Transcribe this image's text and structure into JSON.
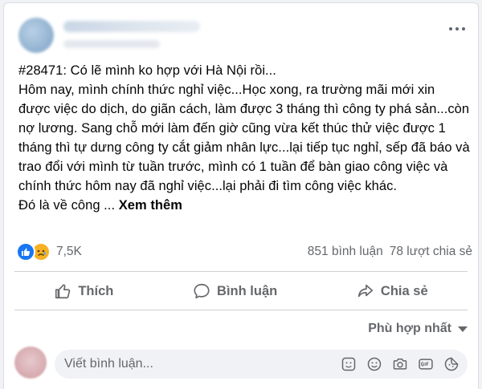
{
  "post": {
    "text_lines": [
      "#28471: Có lẽ mình ko hợp với Hà Nội rồi...",
      "Hôm nay, mình chính thức nghỉ việc...Học xong, ra trường mãi mới xin được việc do dịch, do giãn cách, làm được 3 tháng thì công ty phá sản...còn nợ lương. Sang chỗ mới làm đến giờ cũng vừa kết thúc thử việc được 1 tháng thì tự dưng công ty cắt giảm nhân lực...lại tiếp tục nghỉ, sếp đã báo và trao đổi với mình từ tuần trước, mình có 1 tuần để bàn giao công việc và chính thức hôm nay đã nghỉ việc...lại phải đi tìm công việc khác."
    ],
    "truncated_text": "Đó là về công ...",
    "see_more": "Xem thêm"
  },
  "stats": {
    "reaction_count": "7,5K",
    "comments": "851 bình luận",
    "shares": "78 lượt chia sẻ"
  },
  "actions": {
    "like": "Thích",
    "comment": "Bình luận",
    "share": "Chia sẻ"
  },
  "sort_label": "Phù hợp nhất",
  "comment_input": {
    "placeholder": "Viết bình luận..."
  },
  "colors": {
    "like_blue": "#1877f2",
    "sad_yellow": "#f7b125",
    "secondary_text": "#65676b"
  }
}
